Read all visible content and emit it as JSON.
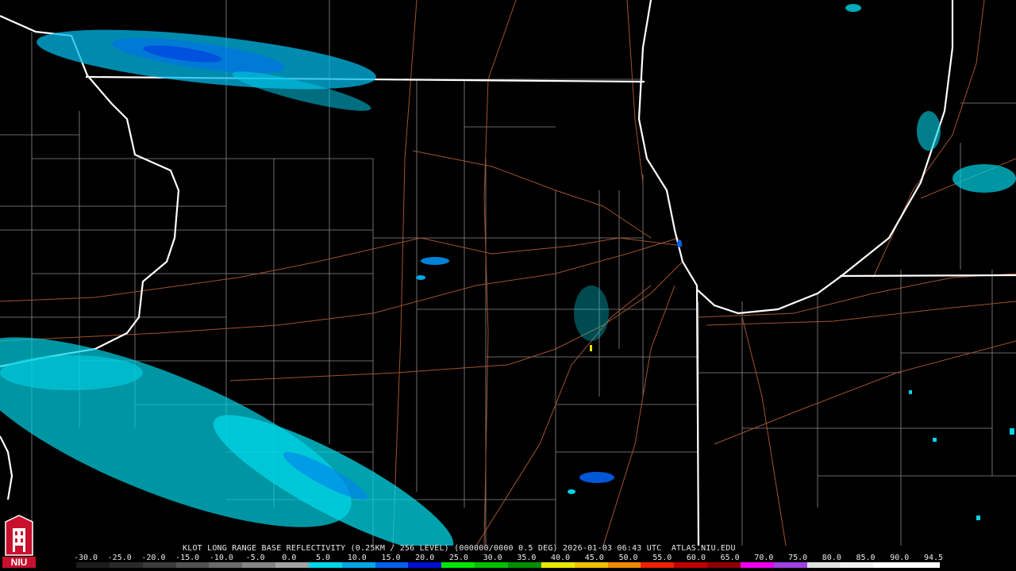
{
  "header": {
    "title": "KLOT LONG RANGE BASE REFLECTIVITY (0.25KM / 256 LEVEL) (000000/0000 0.5 DEG) 2026-01-03 06:43 UTC  ATLAS.NIU.EDU"
  },
  "logo": {
    "text": "NIU",
    "icon": "niu-tower-logo-icon",
    "color": "#c8102e"
  },
  "scale": {
    "labels": [
      "-30.0",
      "-25.0",
      "-20.0",
      "-15.0",
      "-10.0",
      "-5.0",
      "0.0",
      "5.0",
      "10.0",
      "15.0",
      "20.0",
      "25.0",
      "30.0",
      "35.0",
      "40.0",
      "45.0",
      "50.0",
      "55.0",
      "60.0",
      "65.0",
      "70.0",
      "75.0",
      "80.0",
      "85.0",
      "90.0",
      "94.5"
    ],
    "colors": [
      "#1c1c1c",
      "#2a2a2a",
      "#3c3c3c",
      "#525252",
      "#6a6a6a",
      "#858585",
      "#a3a3a3",
      "#00d4e8",
      "#00a8e8",
      "#0060f0",
      "#0010d0",
      "#00e800",
      "#00c000",
      "#009000",
      "#e8e800",
      "#f0c000",
      "#f08800",
      "#f02000",
      "#c00000",
      "#900000",
      "#f000f0",
      "#a040e0",
      "#e0e0e0",
      "#f0f0f0",
      "#ffffff",
      "#ffffff"
    ]
  },
  "map_colors": {
    "state_border": "#ffffff",
    "county_border": "#8a8a8a",
    "highway": "#a0522d",
    "background": "#000000",
    "light_echo": "#00d8e8",
    "mid_echo": "#00a0f0",
    "strong_echo": "#0040e0"
  }
}
